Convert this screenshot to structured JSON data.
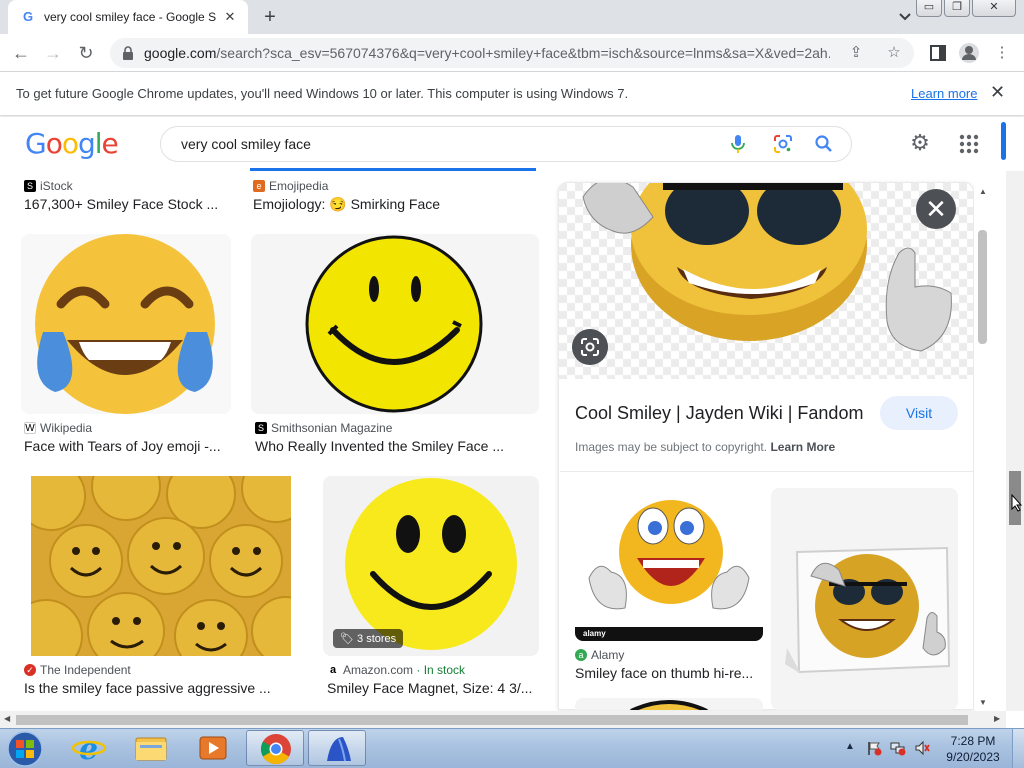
{
  "browser": {
    "tab_title": "very cool smiley face - Google Se",
    "tab_close": "✕",
    "new_tab": "+",
    "url_domain": "google.com",
    "url_path": "/search?sca_esv=567074376&q=very+cool+smiley+face&tbm=isch&source=lnms&sa=X&ved=2ah...",
    "window_buttons": [
      "▭",
      "❐",
      "✕"
    ]
  },
  "infobar": {
    "message": "To get future Google Chrome updates, you'll need Windows 10 or later. This computer is using Windows 7.",
    "learn_more": "Learn more",
    "close": "✕"
  },
  "google": {
    "logo_letters": [
      {
        "ch": "G",
        "color": "#4285f4"
      },
      {
        "ch": "o",
        "color": "#ea4335"
      },
      {
        "ch": "o",
        "color": "#fbbc05"
      },
      {
        "ch": "g",
        "color": "#4285f4"
      },
      {
        "ch": "l",
        "color": "#34a853"
      },
      {
        "ch": "e",
        "color": "#ea4335"
      }
    ],
    "query": "very cool smiley face"
  },
  "results": {
    "r1": {
      "source": "iStock",
      "title": "167,300+ Smiley Face Stock ..."
    },
    "r2": {
      "source": "Emojipedia",
      "title": "Emojiology: 😏 Smirking Face"
    },
    "r3": {
      "source": "Wikipedia",
      "title": "Face with Tears of Joy emoji -..."
    },
    "r4": {
      "source": "Smithsonian Magazine",
      "title": "Who Really Invented the Smiley Face ..."
    },
    "r5": {
      "source": "The Independent",
      "title": "Is the smiley face passive aggressive ..."
    },
    "r6": {
      "source": "Amazon.com",
      "stock": "· In stock",
      "title": "Smiley Face Magnet, Size: 4 3/...",
      "badge": "3 stores"
    }
  },
  "preview": {
    "close": "✕",
    "title": "Cool Smiley | Jayden Wiki | Fandom",
    "visit": "Visit",
    "copyright": "Images may be subject to copyright.",
    "learn_more": "Learn More",
    "related1": {
      "source": "Alamy",
      "title": "Smiley face on thumb hi-re...",
      "watermark": "alamy"
    }
  },
  "taskbar": {
    "time": "7:28 PM",
    "date": "9/20/2023"
  },
  "colors": {
    "accent": "#1a73e8",
    "smiley_yellow": "#f4c430",
    "taskbar": "#a9c2e0"
  }
}
